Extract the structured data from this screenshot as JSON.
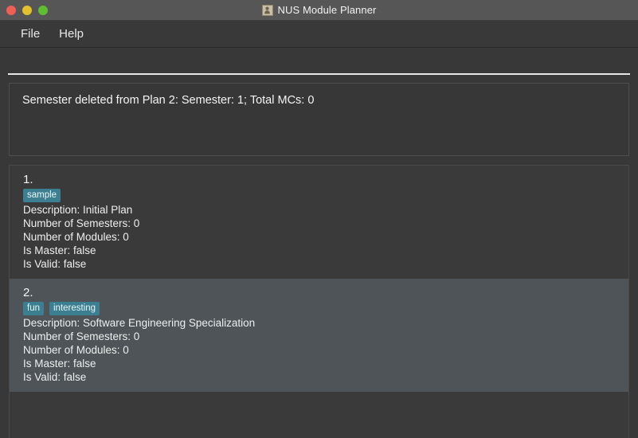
{
  "window": {
    "title": "NUS Module Planner",
    "app_icon": "duke-app-icon",
    "traffic_lights": [
      "close",
      "minimize",
      "maximize"
    ]
  },
  "menubar": {
    "items": [
      {
        "label": "File",
        "name": "menu-file"
      },
      {
        "label": "Help",
        "name": "menu-help"
      }
    ]
  },
  "command": {
    "value": "",
    "placeholder": ""
  },
  "result": {
    "text": "Semester deleted from Plan 2: Semester: 1; Total MCs: 0"
  },
  "plans": {
    "items": [
      {
        "index": "1.",
        "tags": [
          "sample"
        ],
        "description": "Description: Initial Plan",
        "semesters": "Number of Semesters: 0",
        "modules": "Number of Modules: 0",
        "is_master": "Is Master: false",
        "is_valid": "Is Valid: false",
        "selected": false
      },
      {
        "index": "2.",
        "tags": [
          "fun",
          "interesting"
        ],
        "description": "Description: Software Engineering Specialization",
        "semesters": "Number of Semesters: 0",
        "modules": "Number of Modules: 0",
        "is_master": "Is Master: false",
        "is_valid": "Is Valid: false",
        "selected": true
      }
    ]
  },
  "colors": {
    "titlebar": "#565656",
    "window_bg": "#383838",
    "panel_bg": "#3a3a3a",
    "selected_row": "#4e5457",
    "tag_bg": "#3c7f91",
    "text": "#f0f0f0",
    "command_underline": "#e6e6e6",
    "traffic_close": "#ee5f56",
    "traffic_min": "#e3c02c",
    "traffic_max": "#5ec030"
  }
}
